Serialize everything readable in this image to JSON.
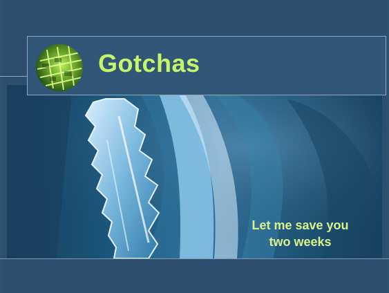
{
  "slide": {
    "title": "Gotchas",
    "callout_line1": "Let me save you",
    "callout_line2": "two weeks"
  },
  "colors": {
    "background": "#2f5170",
    "title_text": "#c6f46a",
    "callout_text": "#d8f28c",
    "border": "#8fa8bf"
  },
  "icons": {
    "logo": "green-circuit-board-icon",
    "hero": "gear-machine-image"
  }
}
